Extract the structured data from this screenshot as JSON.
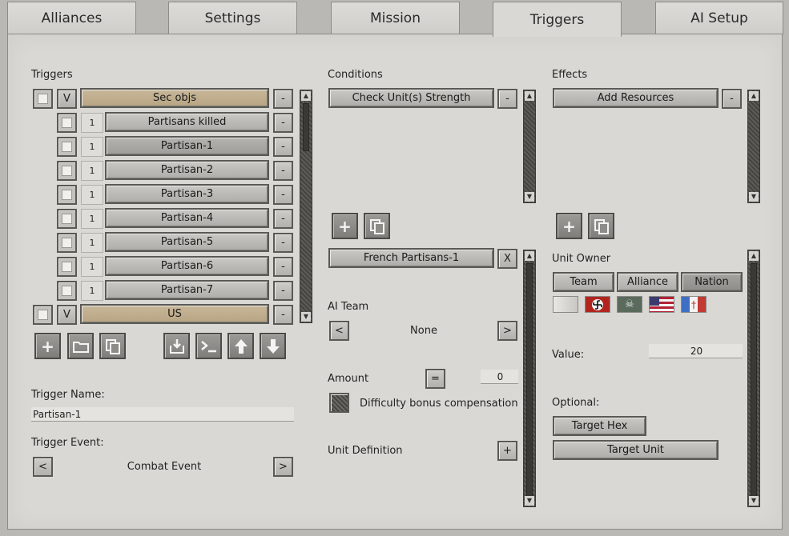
{
  "tabs": [
    "Alliances",
    "Settings",
    "Mission",
    "Triggers",
    "AI Setup"
  ],
  "triggers": {
    "heading": "Triggers",
    "groups": [
      {
        "toggle": "V",
        "label": "Sec objs",
        "minus": "-"
      },
      {
        "toggle": "V",
        "label": "US",
        "minus": "-"
      }
    ],
    "items": [
      {
        "num": "1",
        "label": "Partisans killed",
        "minus": "-"
      },
      {
        "num": "1",
        "label": "Partisan-1",
        "minus": "-"
      },
      {
        "num": "1",
        "label": "Partisan-2",
        "minus": "-"
      },
      {
        "num": "1",
        "label": "Partisan-3",
        "minus": "-"
      },
      {
        "num": "1",
        "label": "Partisan-4",
        "minus": "-"
      },
      {
        "num": "1",
        "label": "Partisan-5",
        "minus": "-"
      },
      {
        "num": "1",
        "label": "Partisan-6",
        "minus": "-"
      },
      {
        "num": "1",
        "label": "Partisan-7",
        "minus": "-"
      }
    ],
    "toolbar_icons": [
      "add-icon",
      "folder-icon",
      "copy-icon",
      "import-icon",
      "console-icon",
      "arrow-up-icon",
      "arrow-down-icon"
    ],
    "name_label": "Trigger Name:",
    "name_value": "Partisan-1",
    "event_label": "Trigger Event:",
    "event_value": "Combat Event",
    "prev": "<",
    "next": ">"
  },
  "conditions": {
    "heading": "Conditions",
    "item": "Check Unit(s) Strength",
    "minus": "-",
    "selected": "French Partisans-1",
    "close": "X",
    "ai_team_label": "AI Team",
    "ai_team_value": "None",
    "prev": "<",
    "next": ">",
    "amount_label": "Amount",
    "amount_op": "=",
    "amount_value": "0",
    "difficulty_label": "Difficulty bonus compensation",
    "unit_def_label": "Unit Definition",
    "unit_def_btn": "+"
  },
  "effects": {
    "heading": "Effects",
    "item": "Add Resources",
    "minus": "-",
    "owner_label": "Unit Owner",
    "owner_options": [
      "Team",
      "Alliance",
      "Nation"
    ],
    "owner_selected": "Nation",
    "flags": [
      "none-flag",
      "germany-flag",
      "skull-flag",
      "usa-flag",
      "france-cross-flag"
    ],
    "value_label": "Value:",
    "value": "20",
    "optional_label": "Optional:",
    "target_hex": "Target Hex",
    "target_unit": "Target Unit"
  },
  "colors": {
    "panel": "#d9d8d4",
    "tan_button": "#c0ae8f",
    "scrollbar": "#4f4e4b"
  }
}
